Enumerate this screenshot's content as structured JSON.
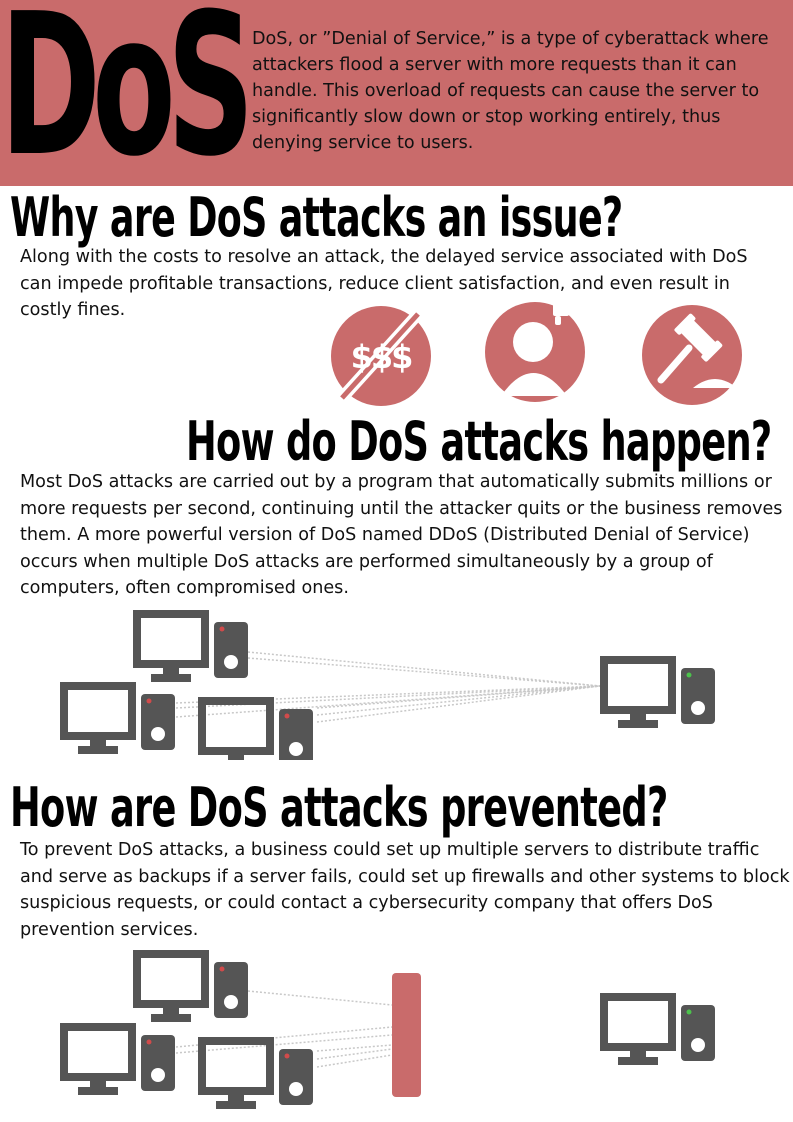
{
  "header": {
    "logo_text": "DoS",
    "intro": "DoS, or ”Denial of Service,” is a type of cyberattack where attackers flood a server with more requests than it can handle. This overload of requests can cause the server to significantly slow down or stop working entirely, thus denying service to users."
  },
  "sections": [
    {
      "heading": "Why are DoS attacks an issue?",
      "body": "Along with the costs to resolve an attack, the delayed service associated with DoS can impede profitable transactions, reduce client satisfaction, and even result in costly fines."
    },
    {
      "heading": "How do DoS attacks happen?",
      "body": "Most DoS attacks are carried out by a program that automatically submits millions or more requests per second, continuing until the attacker quits or the business removes them. A more powerful version of DoS named DDoS (Distributed Denial of Service) occurs when multiple DoS attacks are performed simultaneously by a group of computers, often compromised ones."
    },
    {
      "heading": "How are DoS attacks prevented?",
      "body": "To prevent DoS attacks, a business could set up multiple servers to distribute traffic and serve as backups if a server fails, could set up firewalls and other systems to block suspicious requests, or could contact a cybersecurity company that offers DoS prevention services."
    }
  ],
  "issue_icons": [
    {
      "name": "no-money-icon",
      "text": "$$$"
    },
    {
      "name": "dislike-user-icon"
    },
    {
      "name": "gavel-icon"
    }
  ],
  "colors": {
    "accent": "#c96b6b",
    "device": "#555555",
    "attacker_led": "#d14b4b",
    "server_led": "#4cc24c",
    "line": "#c8c8c8"
  }
}
